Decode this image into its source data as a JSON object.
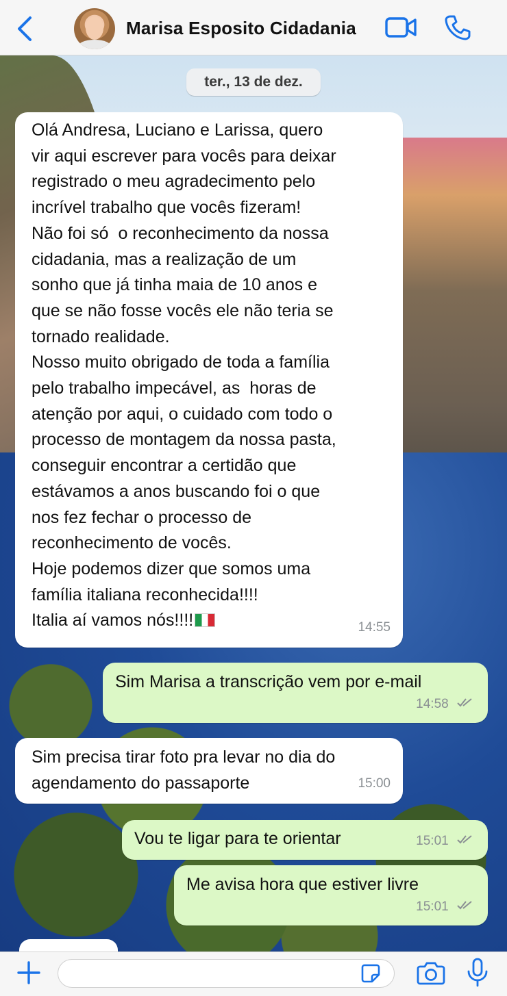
{
  "header": {
    "contact_name": "Marisa Esposito Cidadania",
    "back_icon": "chevron-left-icon",
    "video_icon": "video-call-icon",
    "phone_icon": "phone-icon",
    "accent_color": "#1a73e8"
  },
  "chat": {
    "date_label": "ter., 13 de dez.",
    "messages": [
      {
        "direction": "incoming",
        "text": "Olá Andresa, Luciano e Larissa, quero\nvir aqui escrever para vocês para deixar\nregistrado o meu agradecimento pelo\nincrível trabalho que vocês fizeram!\nNão foi só  o reconhecimento da nossa\ncidadania, mas a realização de um\nsonho que já tinha maia de 10 anos e\nque se não fosse vocês ele não teria se\ntornado realidade.\nNosso muito obrigado de toda a família\npelo trabalho impecável, as  horas de\natenção por aqui, o cuidado com todo o\nprocesso de montagem da nossa pasta,\nconseguir encontrar a certidão que\nestávamos a anos buscando foi o que\nnos fez fechar o processo de\nreconhecimento de vocês.\nHoje podemos dizer que somos uma\nfamília italiana reconhecida!!!!\nItalia aí vamos nós!!!!",
        "emoji": "italy-flag",
        "time": "14:55"
      },
      {
        "direction": "outgoing",
        "text": "Sim Marisa a transcrição vem por e-mail",
        "time": "14:58",
        "status": "read-ticks"
      },
      {
        "direction": "incoming",
        "text": "Sim precisa tirar foto pra levar no dia do\nagendamento do passaporte",
        "time": "15:00"
      },
      {
        "direction": "outgoing",
        "text": "Vou te ligar para te orientar",
        "time": "15:01",
        "status": "read-ticks"
      },
      {
        "direction": "outgoing",
        "text": "Me avisa hora que estiver livre",
        "time": "15:01",
        "status": "read-ticks"
      }
    ]
  },
  "composer": {
    "placeholder": "",
    "value": "",
    "icons": [
      "plus-icon",
      "sticker-icon",
      "camera-icon",
      "microphone-icon"
    ]
  },
  "colors": {
    "incoming_bubble": "#ffffff",
    "outgoing_bubble": "#dcf8c6",
    "icon_blue": "#1a73e8"
  }
}
